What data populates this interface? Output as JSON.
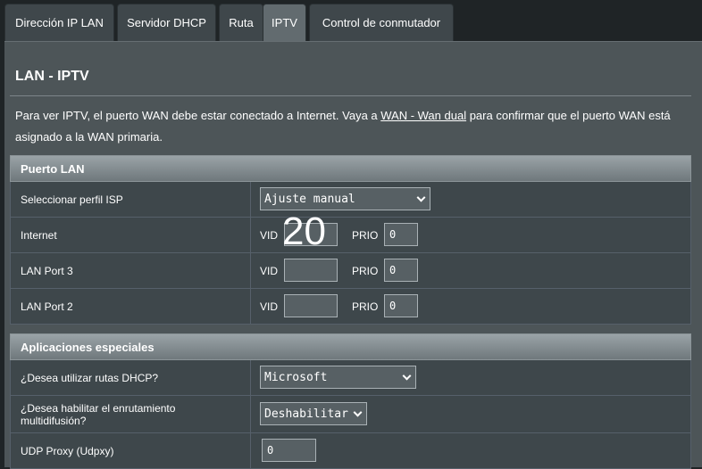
{
  "tabs": [
    {
      "label": "Dirección IP LAN",
      "active": false
    },
    {
      "label": "Servidor DHCP",
      "active": false
    },
    {
      "label": "Ruta",
      "active": false
    },
    {
      "label": "IPTV",
      "active": true
    },
    {
      "label": "Control de conmutador",
      "active": false
    }
  ],
  "page": {
    "title": "LAN - IPTV",
    "description_before": "Para ver IPTV, el puerto WAN debe estar conectado a Internet. Vaya a ",
    "description_link": "WAN - Wan dual",
    "description_after": " para confirmar que el puerto WAN está asignado a la WAN primaria."
  },
  "lan_section": {
    "header": "Puerto LAN",
    "isp_profile": {
      "label": "Seleccionar perfil ISP",
      "value": "Ajuste manual"
    },
    "vid_label": "VID",
    "prio_label": "PRIO",
    "ports": [
      {
        "label": "Internet",
        "vid": "",
        "prio": "0"
      },
      {
        "label": "LAN Port 3",
        "vid": "",
        "prio": "0"
      },
      {
        "label": "LAN Port 2",
        "vid": "",
        "prio": "0"
      }
    ]
  },
  "overlay_text": "20",
  "apps_section": {
    "header": "Aplicaciones especiales",
    "dhcp_routes": {
      "label": "¿Desea utilizar rutas DHCP?",
      "value": "Microsoft"
    },
    "multicast": {
      "label": "¿Desea habilitar el enrutamiento multidifusión?",
      "value": "Deshabilitar"
    },
    "udpxy": {
      "label": "UDP Proxy (Udpxy)",
      "value": "0"
    }
  },
  "colors": {
    "background": "#1f2426",
    "panel": "#4d5558",
    "row": "#3e474b",
    "active_tab": "#626b6f"
  }
}
